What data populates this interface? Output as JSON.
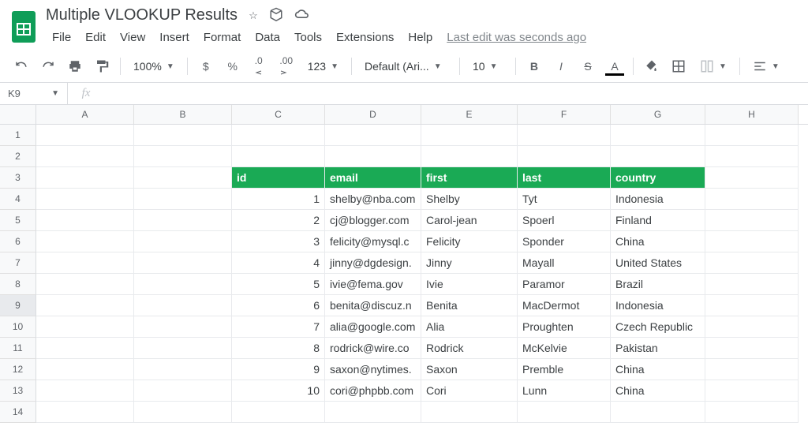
{
  "document": {
    "title": "Multiple VLOOKUP Results",
    "last_edit": "Last edit was seconds ago"
  },
  "menu": [
    "File",
    "Edit",
    "View",
    "Insert",
    "Format",
    "Data",
    "Tools",
    "Extensions",
    "Help"
  ],
  "toolbar": {
    "zoom": "100%",
    "currency": "$",
    "percent": "%",
    "dec_dec": ".0",
    "inc_dec": ".00",
    "num_fmt": "123",
    "font": "Default (Ari...",
    "font_size": "10"
  },
  "name_box": "K9",
  "columns": [
    "A",
    "B",
    "C",
    "D",
    "E",
    "F",
    "G",
    "H"
  ],
  "row_numbers": [
    "1",
    "2",
    "3",
    "4",
    "5",
    "6",
    "7",
    "8",
    "9",
    "10",
    "11",
    "12",
    "13",
    "14"
  ],
  "table": {
    "headers": {
      "id": "id",
      "email": "email",
      "first": "first",
      "last": "last",
      "country": "country"
    },
    "rows": [
      {
        "id": "1",
        "email": "shelby@nba.com",
        "first": "Shelby",
        "last": "Tyt",
        "country": "Indonesia"
      },
      {
        "id": "2",
        "email": "cj@blogger.com",
        "first": "Carol-jean",
        "last": "Spoerl",
        "country": "Finland"
      },
      {
        "id": "3",
        "email": "felicity@mysql.c",
        "first": "Felicity",
        "last": "Sponder",
        "country": "China"
      },
      {
        "id": "4",
        "email": "jinny@dgdesign.",
        "first": "Jinny",
        "last": "Mayall",
        "country": "United States"
      },
      {
        "id": "5",
        "email": "ivie@fema.gov",
        "first": "Ivie",
        "last": "Paramor",
        "country": "Brazil"
      },
      {
        "id": "6",
        "email": "benita@discuz.n",
        "first": "Benita",
        "last": "MacDermot",
        "country": "Indonesia"
      },
      {
        "id": "7",
        "email": "alia@google.com",
        "first": "Alia",
        "last": "Proughten",
        "country": "Czech Republic"
      },
      {
        "id": "8",
        "email": "rodrick@wire.co",
        "first": "Rodrick",
        "last": "McKelvie",
        "country": "Pakistan"
      },
      {
        "id": "9",
        "email": "saxon@nytimes.",
        "first": "Saxon",
        "last": "Premble",
        "country": "China"
      },
      {
        "id": "10",
        "email": "cori@phpbb.com",
        "first": "Cori",
        "last": "Lunn",
        "country": "China"
      }
    ]
  }
}
